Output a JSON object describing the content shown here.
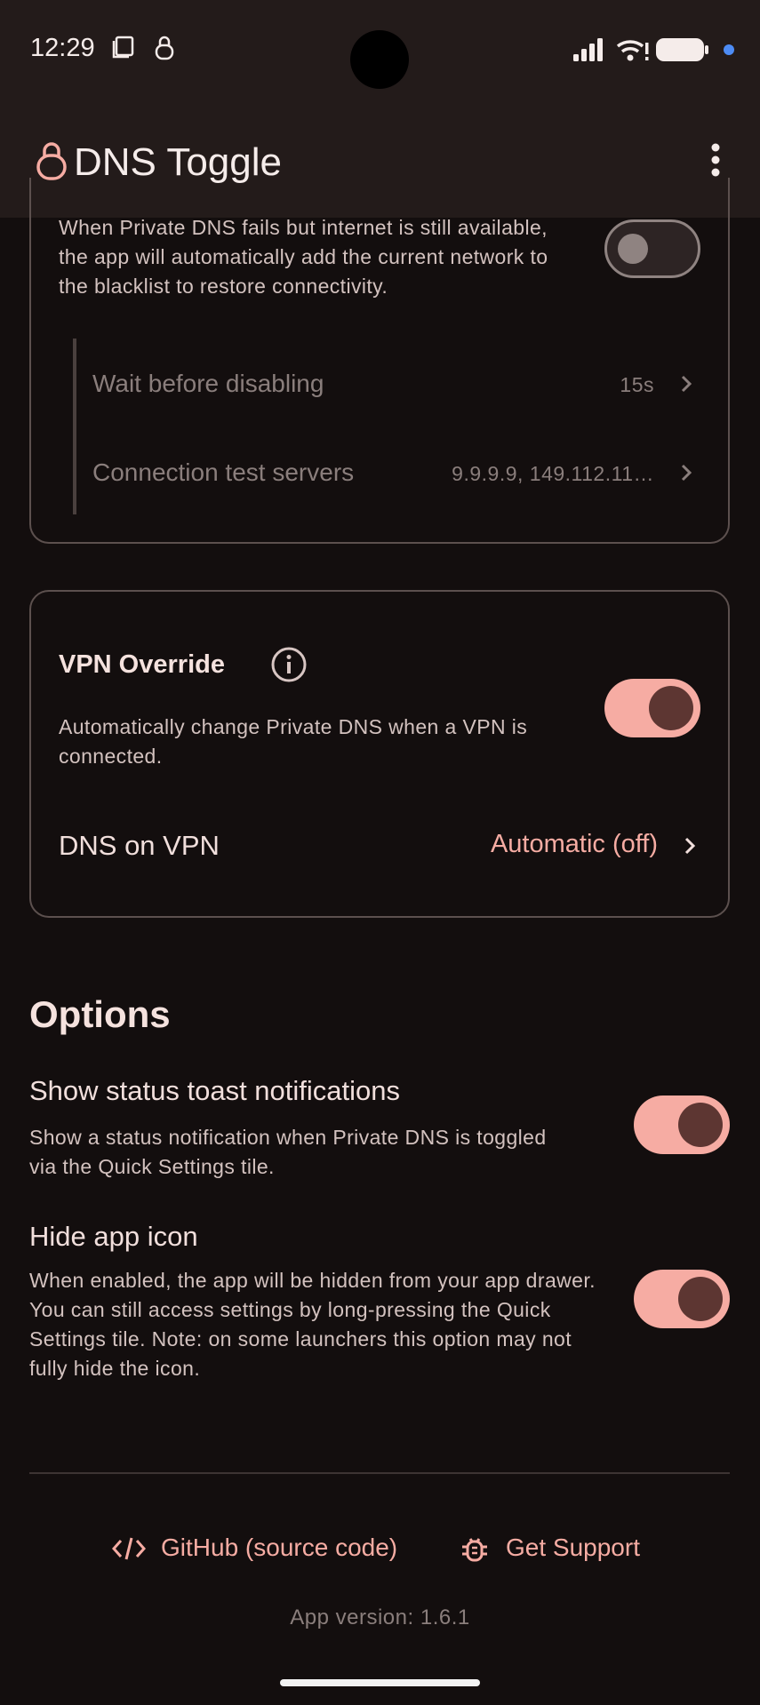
{
  "status_bar": {
    "time": "12:29"
  },
  "app_bar": {
    "title": "DNS Toggle"
  },
  "auto_disable_card": {
    "description": "When Private DNS fails but internet is still available, the app will automatically add the current network to the blacklist to restore connectivity.",
    "toggle_on": false,
    "wait_label": "Wait before disabling",
    "wait_value": "15s",
    "servers_label": "Connection test servers",
    "servers_value": "9.9.9.9, 149.112.11…"
  },
  "vpn_card": {
    "title": "VPN Override",
    "description": "Automatically change Private DNS when a VPN is connected.",
    "toggle_on": true,
    "dns_on_vpn_label": "DNS on VPN",
    "dns_on_vpn_value": "Automatic (off)"
  },
  "options": {
    "heading": "Options",
    "status_toast": {
      "title": "Show status toast notifications",
      "description": "Show a status notification when Private DNS is toggled via the Quick Settings tile.",
      "toggle_on": true
    },
    "hide_icon": {
      "title": "Hide app icon",
      "description": "When enabled, the app will be hidden from your app drawer. You can still access settings by long-pressing the Quick Settings tile. Note: on some launchers this option may not fully hide the icon.",
      "toggle_on": true
    }
  },
  "footer": {
    "github_label": "GitHub (source code)",
    "support_label": "Get Support",
    "version": "App version: 1.6.1"
  },
  "colors": {
    "accent": "#f6aca3",
    "background": "#130e0e",
    "knob_on": "#5d3632"
  }
}
